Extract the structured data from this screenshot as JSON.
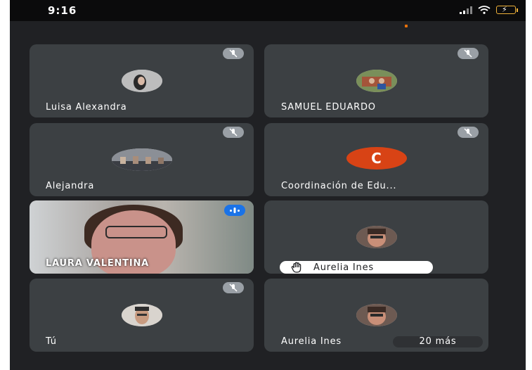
{
  "status_bar": {
    "time": "9:16"
  },
  "participants": [
    {
      "name": "Luisa Alexandra",
      "state": "muted",
      "avatar": "photo"
    },
    {
      "name": "SAMUEL EDUARDO",
      "state": "muted",
      "avatar": "photo"
    },
    {
      "name": "Alejandra",
      "state": "muted",
      "avatar": "photo"
    },
    {
      "name": "Coordinación de Edu...",
      "state": "muted",
      "avatar_letter": "C"
    },
    {
      "name": "LAURA VALENTINA",
      "state": "speaking",
      "video": true
    },
    {
      "name": "Aurelia Ines",
      "state": "hand-raised",
      "avatar": "photo"
    },
    {
      "name": "Tú",
      "state": "muted",
      "avatar": "photo"
    },
    {
      "name": "Aurelia Ines",
      "avatar": "photo",
      "more_label": "20 más"
    }
  ],
  "colors": {
    "background": "#202124",
    "tile": "#3c4043",
    "speaking_accent": "#1a73e8",
    "letter_avatar": "#d84315"
  }
}
